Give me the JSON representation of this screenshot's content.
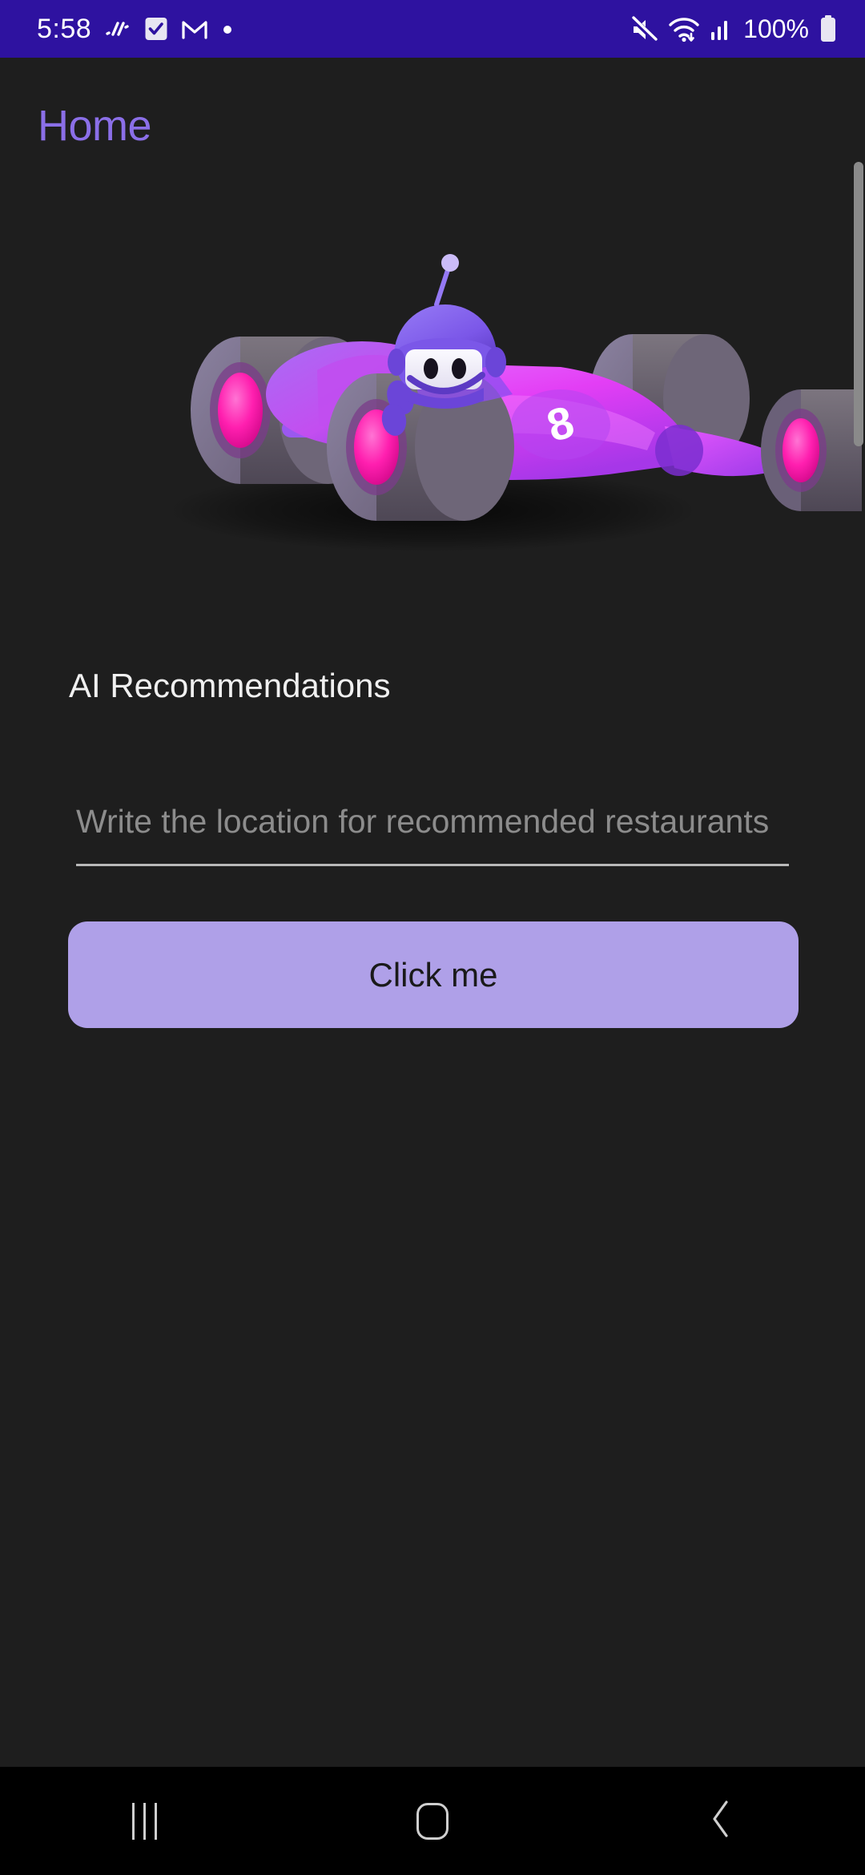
{
  "status_bar": {
    "time": "5:58",
    "battery_percent": "100%",
    "background_color": "#2e12a0",
    "left_icons": [
      "activity-icon",
      "checkbox-icon",
      "gmail-icon",
      "dot-icon"
    ],
    "right_icons": [
      "mute-icon",
      "wifi-icon",
      "signal-icon",
      "battery-icon"
    ]
  },
  "app": {
    "title": "Home",
    "title_color": "#8b6fe8",
    "background_color": "#1e1e1e"
  },
  "hero": {
    "alt": "robot driving a purple race car",
    "car_number": "8",
    "car_body_color": "#d53bf0",
    "car_accent_color": "#8b4ff0",
    "wheel_color": "#6b6470",
    "wheel_hub_color": "#ff1faf",
    "helmet_color": "#7b57e8",
    "face_color": "#f5f3f7"
  },
  "main": {
    "section_label": "AI Recommendations",
    "input": {
      "placeholder": "Write the location for recommended restaurants",
      "value": "",
      "underline_color": "#b9b9b9"
    },
    "button": {
      "label": "Click me",
      "background_color": "#afa0e8",
      "text_color": "#1a1a1a"
    }
  },
  "scrollbar": {
    "visible": true,
    "thumb_color": "#8a8a8a"
  },
  "nav_bar": {
    "background_color": "#000000",
    "buttons": [
      {
        "name": "recents-button",
        "icon": "recents-icon"
      },
      {
        "name": "home-button",
        "icon": "home-icon"
      },
      {
        "name": "back-button",
        "icon": "back-chevron-icon"
      }
    ]
  }
}
